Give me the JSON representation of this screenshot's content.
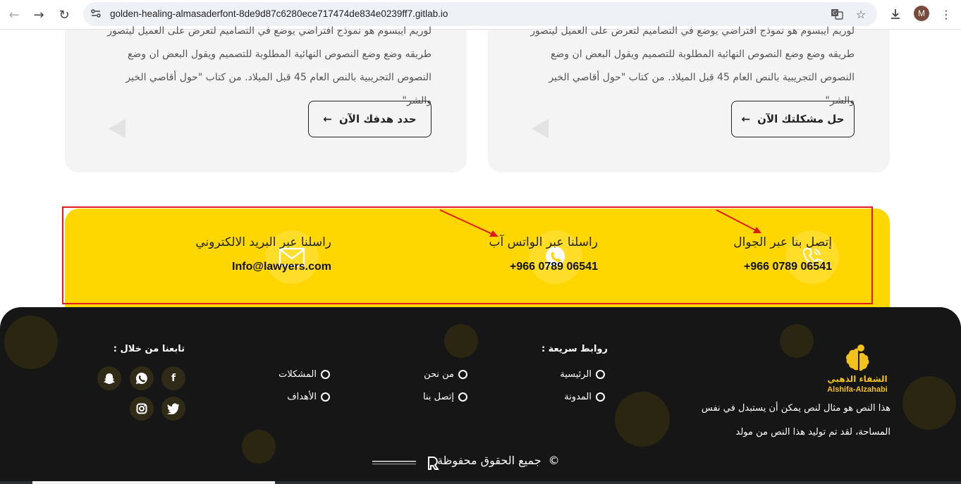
{
  "browser": {
    "url": "golden-healing-almasaderfont-8de9d87c6280ece717474de834e0239ff7.gitlab.io",
    "avatar_letter": "M"
  },
  "cards": [
    {
      "text": "لوريم ايبسوم هو نموذج افتراضي يوضع في التصاميم لتعرض على العميل ليتصور طريقه وضع وضع النصوص النهائية المطلوبة للتصميم ويقول البعض ان وضع النصوص التجريبية بالنص العام 45 قبل الميلاد. من كتاب \"حول أقاصي الخير والشر\"",
      "button_label": "حدد هدفك الآن",
      "arrow": "←"
    },
    {
      "text": "لوريم ايبسوم هو نموذج افتراضي يوضع في التصاميم لتعرض على العميل ليتصور طريقه وضع وضع النصوص النهائية المطلوبة للتصميم ويقول البعض ان وضع النصوص التجريبية بالنص العام 45 قبل الميلاد. من كتاب \"حول أقاصي الخير والشر\"",
      "button_label": "حل مشكلتك الآن",
      "arrow": "←"
    }
  ],
  "contact": {
    "band_color": "#ffd700",
    "highlight_color": "#e01b1b",
    "items": [
      {
        "icon": "phone-icon",
        "title": "إتصل بنا عبر الجوال",
        "value": "+966 0789 06541"
      },
      {
        "icon": "whatsapp-icon",
        "title": "راسلنا عبر الواتس آب",
        "value": "+966 0789 06541"
      },
      {
        "icon": "mail-icon",
        "title": "راسلنا عبر البريد الالكتروني",
        "value": "Info@lawyers.com"
      }
    ]
  },
  "footer": {
    "logo_ar": "الشفاء الذهبي",
    "logo_en": "Alshifa-Alzahabi",
    "brand_color": "#f2c21b",
    "about": "هذا النص هو مثال لنص يمكن أن يستبدل في نفس المساحة، لقد تم توليد هذا النص من مولد",
    "quick_links_heading": "روابط سريعة :",
    "links": {
      "home": "الرئيسية",
      "blog": "المدونة",
      "about": "من نحن",
      "contact": "إتصل بنا",
      "problems": "المشكلات",
      "goals": "الأهداف"
    },
    "follow_heading": "تابعنا من خلال :",
    "social": [
      "facebook-icon",
      "whatsapp-icon",
      "snapchat-icon",
      "twitter-icon",
      "instagram-icon"
    ],
    "copyright_symbol": "©",
    "copyright_text": "جميع الحقوق محفوظة"
  }
}
